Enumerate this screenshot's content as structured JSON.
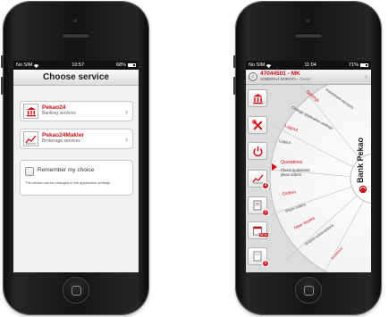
{
  "left_phone": {
    "status": {
      "carrier": "No SIM",
      "time": "10:57",
      "battery": "68%"
    },
    "title": "Choose service",
    "services": [
      {
        "name": "Pekao24",
        "description": "Banking services"
      },
      {
        "name": "Pekao24Makler",
        "description": "Brokerage services"
      }
    ],
    "remember": {
      "label": "Remember my choice",
      "note": "The choice can be changed in the application settings"
    }
  },
  "right_phone": {
    "status": {
      "carrier": "No SIM",
      "time": "11:04",
      "battery": "71%"
    },
    "account_id": "47044501 - MK",
    "owner_name": "SOBIERAJ DOROTA",
    "owner_role": "Owner",
    "menu": [
      {
        "title": "Settings",
        "subtitle": "Change application settings",
        "extra": "Investment services"
      },
      {
        "title": "Logout",
        "subtitle": "Logout"
      },
      {
        "title": "Quotations",
        "subtitle": "Check quotations, place orders"
      },
      {
        "title": "Orders",
        "subtitle": "Place orders"
      },
      {
        "title": "New issues",
        "subtitle": "Submit subscriptions",
        "extra": "Investors"
      }
    ],
    "brand": "Bank Pekao",
    "rail_badges": [
      "4",
      "0",
      "NEW",
      "0"
    ]
  },
  "colors": {
    "accent": "#cc1017",
    "screen_bg": "#f1f1f1",
    "phone_body": "#141414"
  }
}
